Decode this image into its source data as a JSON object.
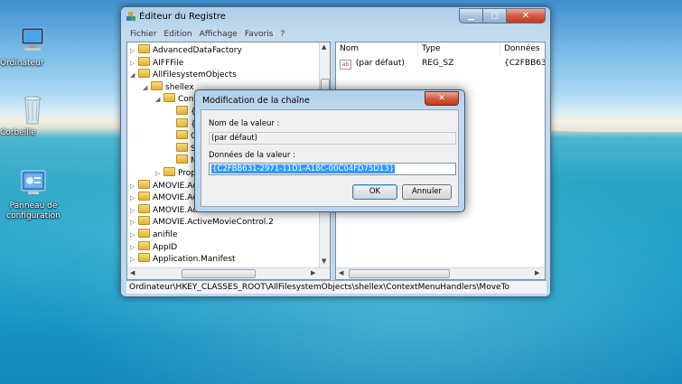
{
  "desktop": {
    "icons": [
      {
        "label": "Ordinateur"
      },
      {
        "label": "Corbeille"
      },
      {
        "label": "Panneau de configuration"
      }
    ]
  },
  "window": {
    "title": "Éditeur du Registre",
    "menu": [
      "Fichier",
      "Edition",
      "Affichage",
      "Favoris",
      "?"
    ],
    "tree": [
      {
        "label": "AdvancedDataFactory",
        "level": 0,
        "expander": "▷"
      },
      {
        "label": "AIFFFile",
        "level": 0,
        "expander": "▷"
      },
      {
        "label": "AllFilesystemObjects",
        "level": 0,
        "expander": "◢"
      },
      {
        "label": "shellex",
        "level": 1,
        "expander": "◢"
      },
      {
        "label": "Cont",
        "level": 2,
        "expander": "◢"
      },
      {
        "label": "{",
        "level": 3,
        "expander": ""
      },
      {
        "label": "{5",
        "level": 3,
        "expander": ""
      },
      {
        "label": "C",
        "level": 3,
        "expander": ""
      },
      {
        "label": "Se",
        "level": 3,
        "expander": ""
      },
      {
        "label": "M",
        "level": 3,
        "expander": ""
      },
      {
        "label": "Prope",
        "level": 2,
        "expander": "▷"
      },
      {
        "label": "AMOVIE.Activ",
        "level": 0,
        "expander": "▷"
      },
      {
        "label": "AMOVIE.Activ",
        "level": 0,
        "expander": "▷"
      },
      {
        "label": "AMOVIE.Activ",
        "level": 0,
        "expander": "▷"
      },
      {
        "label": "AMOVIE.ActiveMovieControl.2",
        "level": 0,
        "expander": "▷"
      },
      {
        "label": "anifile",
        "level": 0,
        "expander": "▷"
      },
      {
        "label": "AppID",
        "level": 0,
        "expander": "▷"
      },
      {
        "label": "Application.Manifest",
        "level": 0,
        "expander": "▷"
      }
    ],
    "list": {
      "headers": [
        "Nom",
        "Type",
        "Données"
      ],
      "rows": [
        {
          "name": "(par défaut)",
          "type": "REG_SZ",
          "data": "{C2FBB631"
        }
      ]
    },
    "status": "Ordinateur\\HKEY_CLASSES_ROOT\\AllFilesystemObjects\\shellex\\ContextMenuHandlers\\MoveTo"
  },
  "dialog": {
    "title": "Modification de la chaîne",
    "value_name_label": "Nom de la valeur :",
    "value_name": "(par défaut)",
    "value_data_label": "Données de la valeur :",
    "value_data": "{C2FBB631-2971-11D1-A18C-00C04FD75D13}",
    "ok_label": "OK",
    "cancel_label": "Annuler"
  },
  "colors": {
    "selection": "#3399ff",
    "close_button": "#d35c44"
  }
}
